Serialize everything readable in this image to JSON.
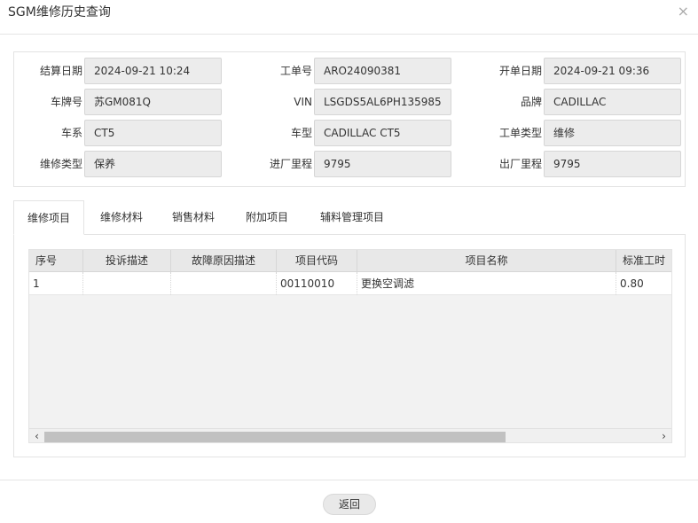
{
  "window": {
    "title": "SGM维修历史查询",
    "close_glyph": "×"
  },
  "form": {
    "settle_date": {
      "label": "结算日期",
      "value": "2024-09-21 10:24"
    },
    "order_no": {
      "label": "工单号",
      "value": "ARO24090381"
    },
    "open_date": {
      "label": "开单日期",
      "value": "2024-09-21 09:36"
    },
    "plate_no": {
      "label": "车牌号",
      "value": "苏GM081Q"
    },
    "vin": {
      "label": "VIN",
      "value": "LSGDS5AL6PH135985"
    },
    "brand": {
      "label": "品牌",
      "value": "CADILLAC"
    },
    "series": {
      "label": "车系",
      "value": "CT5"
    },
    "model": {
      "label": "车型",
      "value": "CADILLAC CT5"
    },
    "order_type": {
      "label": "工单类型",
      "value": "维修"
    },
    "repair_type": {
      "label": "维修类型",
      "value": "保养"
    },
    "in_mileage": {
      "label": "进厂里程",
      "value": "9795"
    },
    "out_mileage": {
      "label": "出厂里程",
      "value": "9795"
    }
  },
  "tabs": [
    {
      "label": "维修项目",
      "active": true
    },
    {
      "label": "维修材料",
      "active": false
    },
    {
      "label": "销售材料",
      "active": false
    },
    {
      "label": "附加项目",
      "active": false
    },
    {
      "label": "辅料管理项目",
      "active": false
    }
  ],
  "grid": {
    "columns": [
      "序号",
      "投诉描述",
      "故障原因描述",
      "项目代码",
      "项目名称",
      "标准工时"
    ],
    "rows": [
      [
        "1",
        "",
        "",
        "00110010",
        "更换空调滤",
        "0.80"
      ]
    ]
  },
  "scrollbar": {
    "left_arrow": "‹",
    "right_arrow": "›"
  },
  "footer": {
    "back_label": "返回"
  }
}
